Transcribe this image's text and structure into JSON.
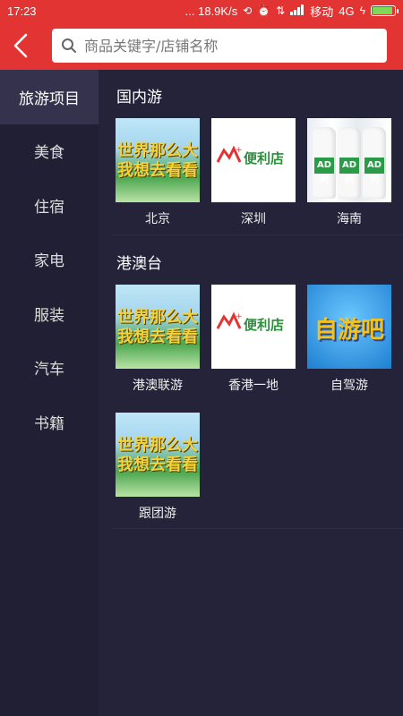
{
  "status": {
    "time": "17:23",
    "speed": "... 18.9K/s",
    "carrier": "移动",
    "network": "4G",
    "battery_level": 0.95
  },
  "search": {
    "placeholder": "商品关键字/店铺名称"
  },
  "sidebar": {
    "items": [
      {
        "label": "旅游项目"
      },
      {
        "label": "美食"
      },
      {
        "label": "住宿"
      },
      {
        "label": "家电"
      },
      {
        "label": "服装"
      },
      {
        "label": "汽车"
      },
      {
        "label": "书籍"
      }
    ],
    "active_index": 0
  },
  "sections": [
    {
      "title": "国内游",
      "items": [
        {
          "label": "北京",
          "image": "travel-poster",
          "poster_text": "世界那么大 我想去看看"
        },
        {
          "label": "深圳",
          "image": "convenience-store-logo",
          "logo_text": "便利店"
        },
        {
          "label": "海南",
          "image": "ad-milk-bottles",
          "bottle_text": "AD钙"
        }
      ]
    },
    {
      "title": "港澳台",
      "items": [
        {
          "label": "港澳联游",
          "image": "travel-poster",
          "poster_text": "世界那么大 我想去看看"
        },
        {
          "label": "香港一地",
          "image": "convenience-store-logo",
          "logo_text": "便利店"
        },
        {
          "label": "自驾游",
          "image": "ziyou-poster",
          "poster_text": "自游吧"
        },
        {
          "label": "跟团游",
          "image": "travel-poster",
          "poster_text": "世界那么大 我想去看看"
        }
      ]
    }
  ],
  "colors": {
    "header_red": "#e23433",
    "background": "#252339",
    "sidebar": "#211f34",
    "sidebar_active": "#34324c"
  }
}
